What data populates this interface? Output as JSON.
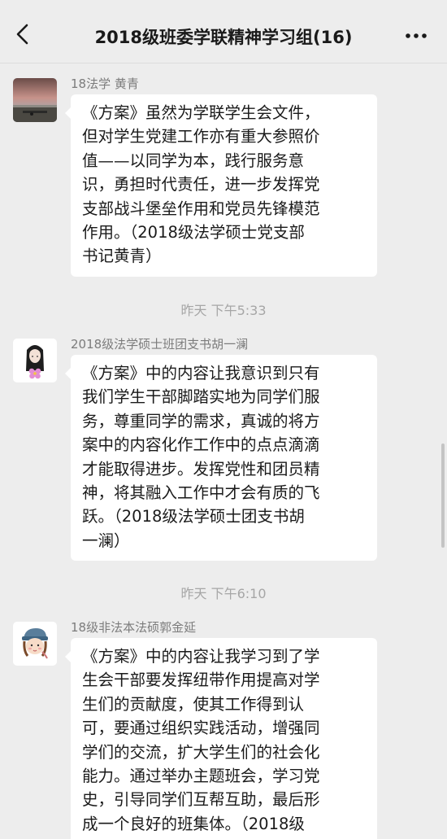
{
  "header": {
    "title": "2018级班委学联精神学习组(16)",
    "back_icon": "chevron-left-icon",
    "more_icon": "more-dots-icon"
  },
  "messages": [
    {
      "sender": "18法学 黄青",
      "avatar_icon": "landscape-photo-avatar",
      "text": "《方案》虽然为学联学生会文件，\n但对学生党建工作亦有重大参照价\n值——以同学为本，践行服务意\n识，勇担时代责任，进一步发挥党\n支部战斗堡垒作用和党员先锋模范\n作用。（2018级法学硕士党支部\n书记黄青）"
    },
    {
      "sender": "2018级法学硕士班团支书胡一澜",
      "avatar_icon": "girl-flower-avatar",
      "text": "《方案》中的内容让我意识到只有\n我们学生干部脚踏实地为同学们服\n务，尊重同学的需求，真诚的将方\n案中的内容化作工作中的点点滴滴\n才能取得进步。发挥党性和团员精\n神，将其融入工作中才会有质的飞\n跃。（2018级法学硕士团支书胡\n一澜）"
    },
    {
      "sender": "18级非法本法硕郭金延",
      "avatar_icon": "cartoon-girl-avatar",
      "text": "《方案》中的内容让我学习到了学\n生会干部要发挥纽带作用提高对学\n生们的贡献度，使其工作得到认\n可，要通过组织实践活动，增强同\n学们的交流，扩大学生们的社会化\n能力。通过举办主题班会，学习党\n史，引导同学们互帮互助，最后形\n成一个良好的班集体。（2018级"
    }
  ],
  "timestamps": [
    "昨天 下午5:33",
    "昨天 下午6:10"
  ]
}
